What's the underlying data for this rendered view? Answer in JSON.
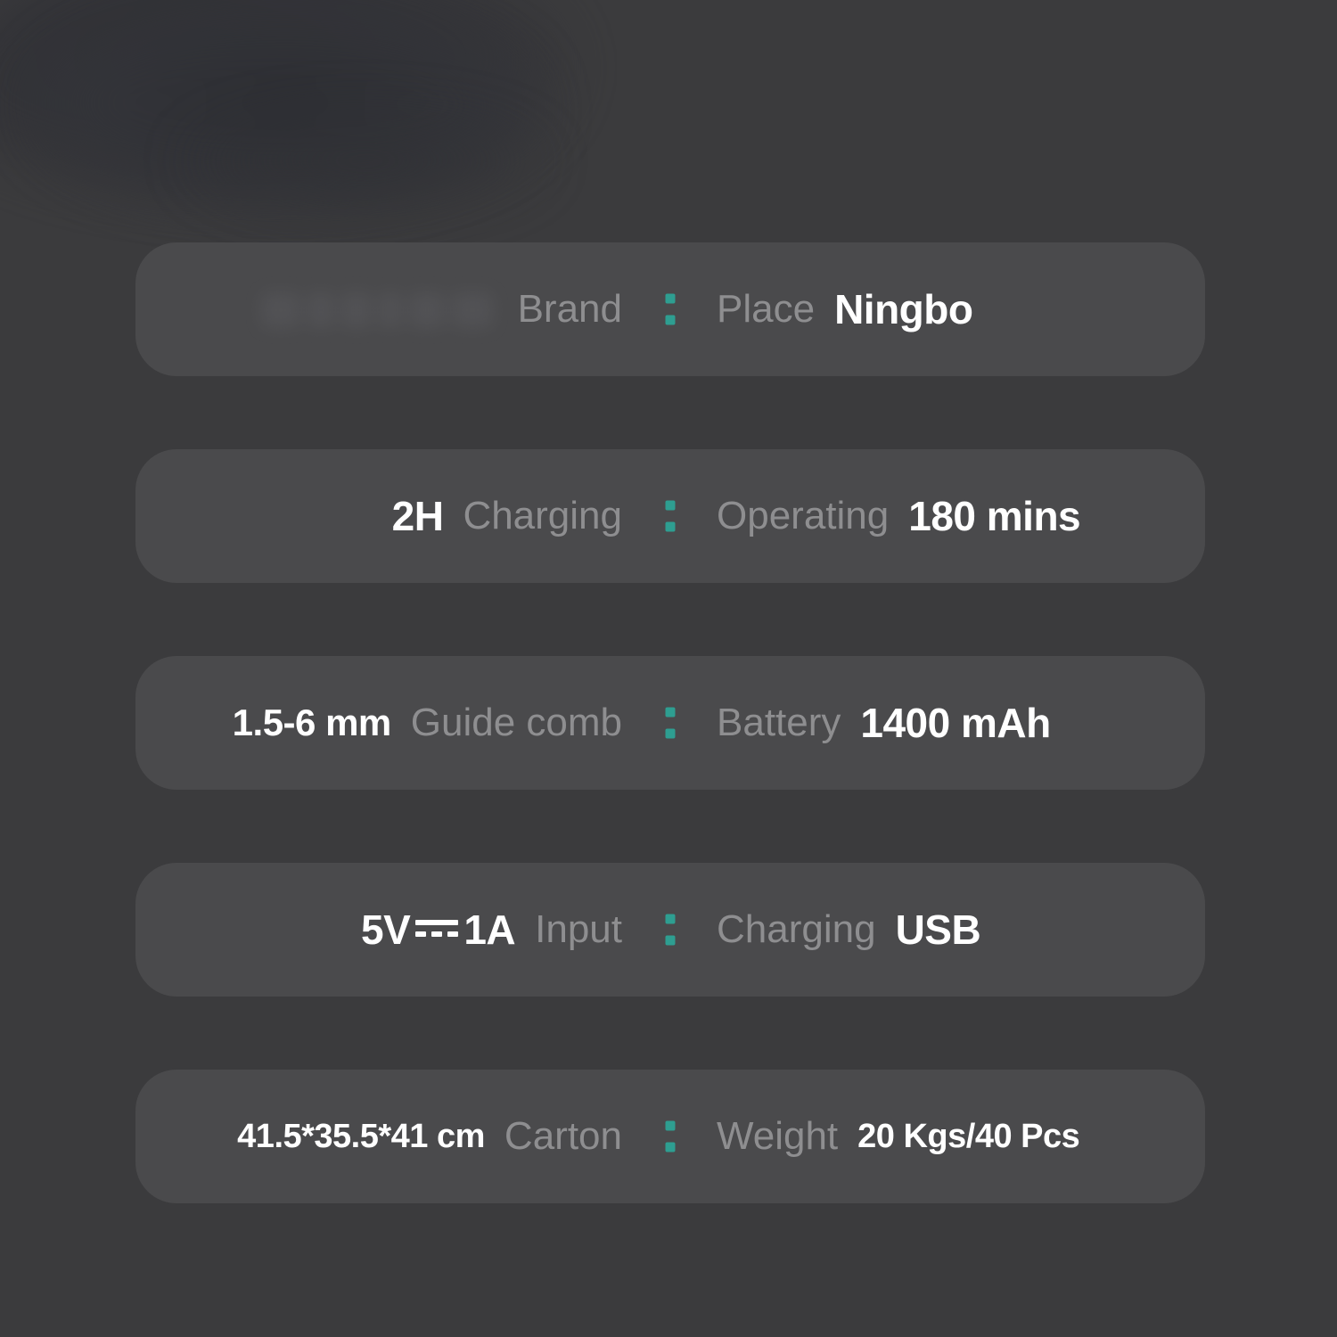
{
  "page": {
    "background_color": "#3b3b3d",
    "pill_color": "#4a4a4c",
    "accent_color": "#2e9e91",
    "value_color": "#ffffff",
    "label_color": "#8e8e90"
  },
  "spec_rows": [
    {
      "left_value": "",
      "left_value_kind": "redacted-logo",
      "left_label": "Brand",
      "right_label": "Place",
      "right_value": "Ningbo"
    },
    {
      "left_value": "2H",
      "left_value_kind": "text",
      "left_label": "Charging",
      "right_label": "Operating",
      "right_value": "180 mins"
    },
    {
      "left_value": "1.5-6 mm",
      "left_value_kind": "text",
      "left_label": "Guide comb",
      "right_label": "Battery",
      "right_value": "1400 mAh"
    },
    {
      "left_value_prefix": "5V",
      "left_value_suffix": "1A",
      "left_value_kind": "dc-power",
      "left_label": "Input",
      "right_label": "Charging",
      "right_value": "USB"
    },
    {
      "left_value": "41.5*35.5*41 cm",
      "left_value_kind": "text",
      "left_label": "Carton",
      "right_label": "Weight",
      "right_value": "20 Kgs/40 Pcs"
    }
  ]
}
